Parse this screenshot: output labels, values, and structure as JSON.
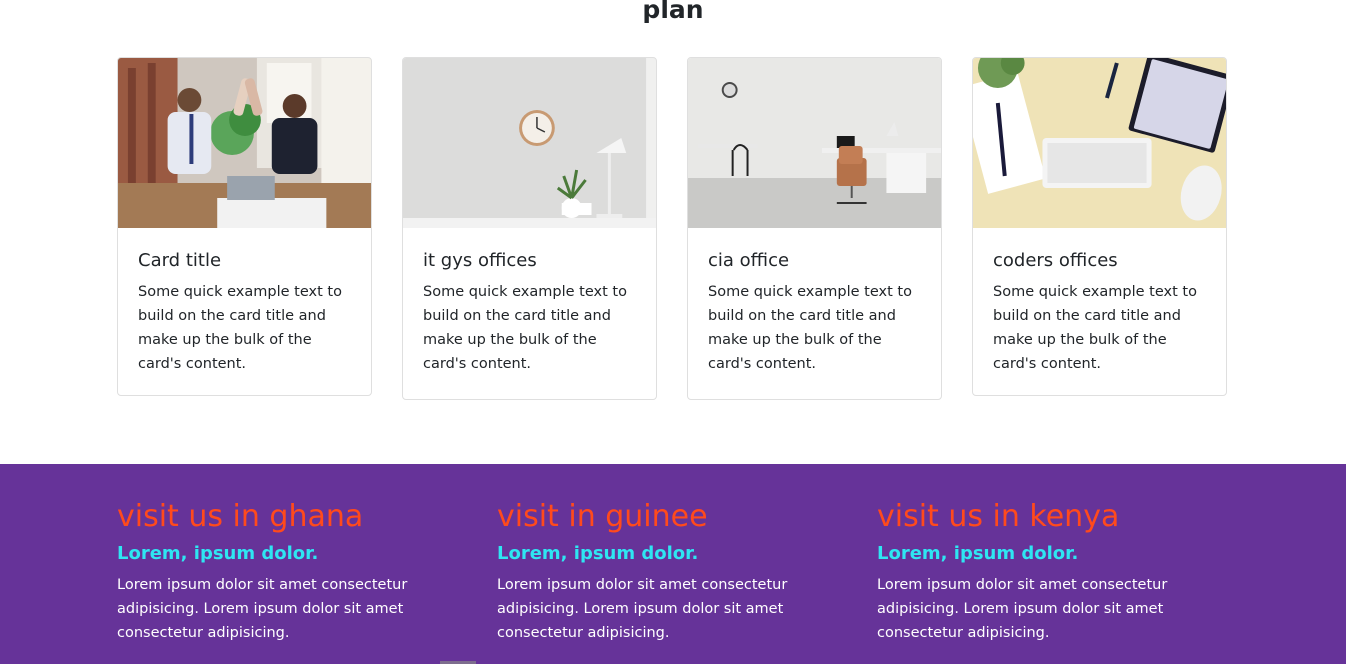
{
  "section": {
    "heading": "plan"
  },
  "cards": [
    {
      "title": "Card title",
      "text": "Some quick example text to build on the card title and make up the bulk of the card's content."
    },
    {
      "title": "it gys offices",
      "text": "Some quick example text to build on the card title and make up the bulk of the card's content."
    },
    {
      "title": "cia office",
      "text": "Some quick example text to build on the card title and make up the bulk of the card's content."
    },
    {
      "title": "coders offices",
      "text": "Some quick example text to build on the card title and make up the bulk of the card's content."
    }
  ],
  "footer": {
    "columns": [
      {
        "heading": "visit us in ghana",
        "subheading": "Lorem, ipsum dolor.",
        "text": "Lorem ipsum dolor sit amet consectetur adipisicing. Lorem ipsum dolor sit amet consectetur adipisicing."
      },
      {
        "heading": "visit in guinee",
        "subheading": "Lorem, ipsum dolor.",
        "text": "Lorem ipsum dolor sit amet consectetur adipisicing. Lorem ipsum dolor sit amet consectetur adipisicing."
      },
      {
        "heading": "visit us in kenya",
        "subheading": "Lorem, ipsum dolor.",
        "text": "Lorem ipsum dolor sit amet consectetur adipisicing. Lorem ipsum dolor sit amet consectetur adipisicing."
      }
    ]
  },
  "colors": {
    "footer_background": "#663399",
    "footer_heading": "#ff4a1c",
    "footer_subheading": "#2ee6f2"
  }
}
